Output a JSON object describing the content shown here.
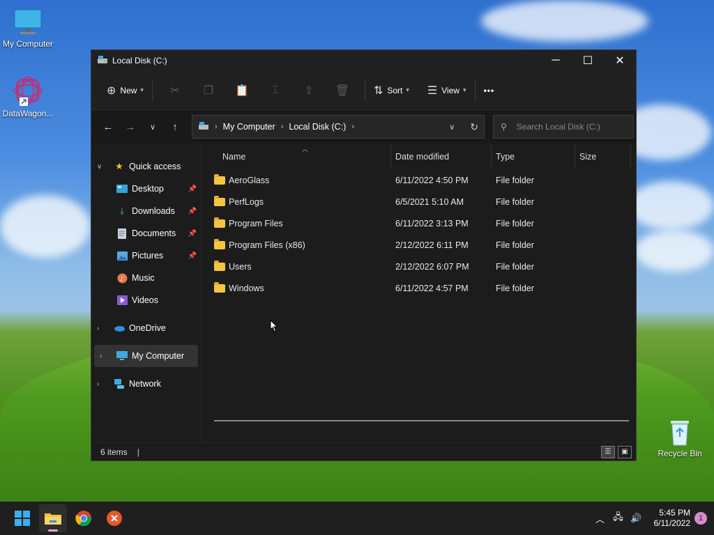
{
  "desktop": {
    "icons": [
      {
        "label": "My Computer"
      },
      {
        "label": "DataWagon..."
      },
      {
        "label": "Recycle Bin"
      }
    ]
  },
  "window": {
    "title": "Local Disk (C:)",
    "controls": {
      "minimize": "─",
      "maximize": "☐",
      "close": "✕"
    },
    "toolbar": {
      "new_label": "New",
      "sort_label": "Sort",
      "view_label": "View",
      "more_label": "•••"
    },
    "address": {
      "crumbs": [
        "My Computer",
        "Local Disk (C:)"
      ]
    },
    "search": {
      "placeholder": "Search Local Disk (C:)"
    },
    "nav": {
      "quick_access": "Quick access",
      "items": [
        {
          "label": "Desktop",
          "pinned": true
        },
        {
          "label": "Downloads",
          "pinned": true
        },
        {
          "label": "Documents",
          "pinned": true
        },
        {
          "label": "Pictures",
          "pinned": true
        },
        {
          "label": "Music",
          "pinned": false
        },
        {
          "label": "Videos",
          "pinned": false
        }
      ],
      "onedrive": "OneDrive",
      "my_computer": "My Computer",
      "network": "Network"
    },
    "columns": {
      "name": "Name",
      "date": "Date modified",
      "type": "Type",
      "size": "Size"
    },
    "files": [
      {
        "name": "AeroGlass",
        "date": "6/11/2022 4:50 PM",
        "type": "File folder"
      },
      {
        "name": "PerfLogs",
        "date": "6/5/2021 5:10 AM",
        "type": "File folder"
      },
      {
        "name": "Program Files",
        "date": "6/11/2022 3:13 PM",
        "type": "File folder"
      },
      {
        "name": "Program Files (x86)",
        "date": "2/12/2022 6:11 PM",
        "type": "File folder"
      },
      {
        "name": "Users",
        "date": "2/12/2022 6:07 PM",
        "type": "File folder"
      },
      {
        "name": "Windows",
        "date": "6/11/2022 4:57 PM",
        "type": "File folder"
      }
    ],
    "status": {
      "count": "6 items"
    }
  },
  "taskbar": {
    "time": "5:45 PM",
    "date": "6/11/2022",
    "notification_count": "1"
  }
}
